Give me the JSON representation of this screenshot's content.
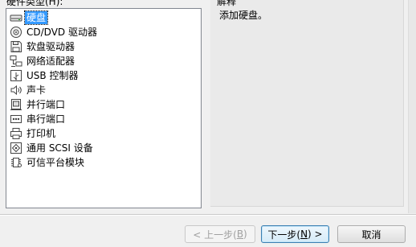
{
  "header": {
    "list_title": "硬件类型(H):",
    "description_title": "解释"
  },
  "hardware_list": [
    {
      "label": "硬盘",
      "icon": "hard-disk-icon",
      "selected": true
    },
    {
      "label": "CD/DVD 驱动器",
      "icon": "cd-dvd-icon",
      "selected": false
    },
    {
      "label": "软盘驱动器",
      "icon": "floppy-icon",
      "selected": false
    },
    {
      "label": "网络适配器",
      "icon": "network-adapter-icon",
      "selected": false
    },
    {
      "label": "USB 控制器",
      "icon": "usb-icon",
      "selected": false
    },
    {
      "label": "声卡",
      "icon": "sound-card-icon",
      "selected": false
    },
    {
      "label": "并行端口",
      "icon": "parallel-port-icon",
      "selected": false
    },
    {
      "label": "串行端口",
      "icon": "serial-port-icon",
      "selected": false
    },
    {
      "label": "打印机",
      "icon": "printer-icon",
      "selected": false
    },
    {
      "label": "通用 SCSI 设备",
      "icon": "scsi-icon",
      "selected": false
    },
    {
      "label": "可信平台模块",
      "icon": "tpm-icon",
      "selected": false
    }
  ],
  "description": {
    "text": "添加硬盘。"
  },
  "buttons": {
    "back": {
      "text": "< 上一步(",
      "key": "B",
      "suffix": ")",
      "enabled": false
    },
    "next": {
      "text": "下一步(",
      "key": "N",
      "suffix": ") >",
      "enabled": true
    },
    "cancel": {
      "text": "取消",
      "enabled": true
    }
  },
  "colors": {
    "selection": "#3399ff",
    "panel": "#eaeaea",
    "window": "#f0f0f0"
  }
}
